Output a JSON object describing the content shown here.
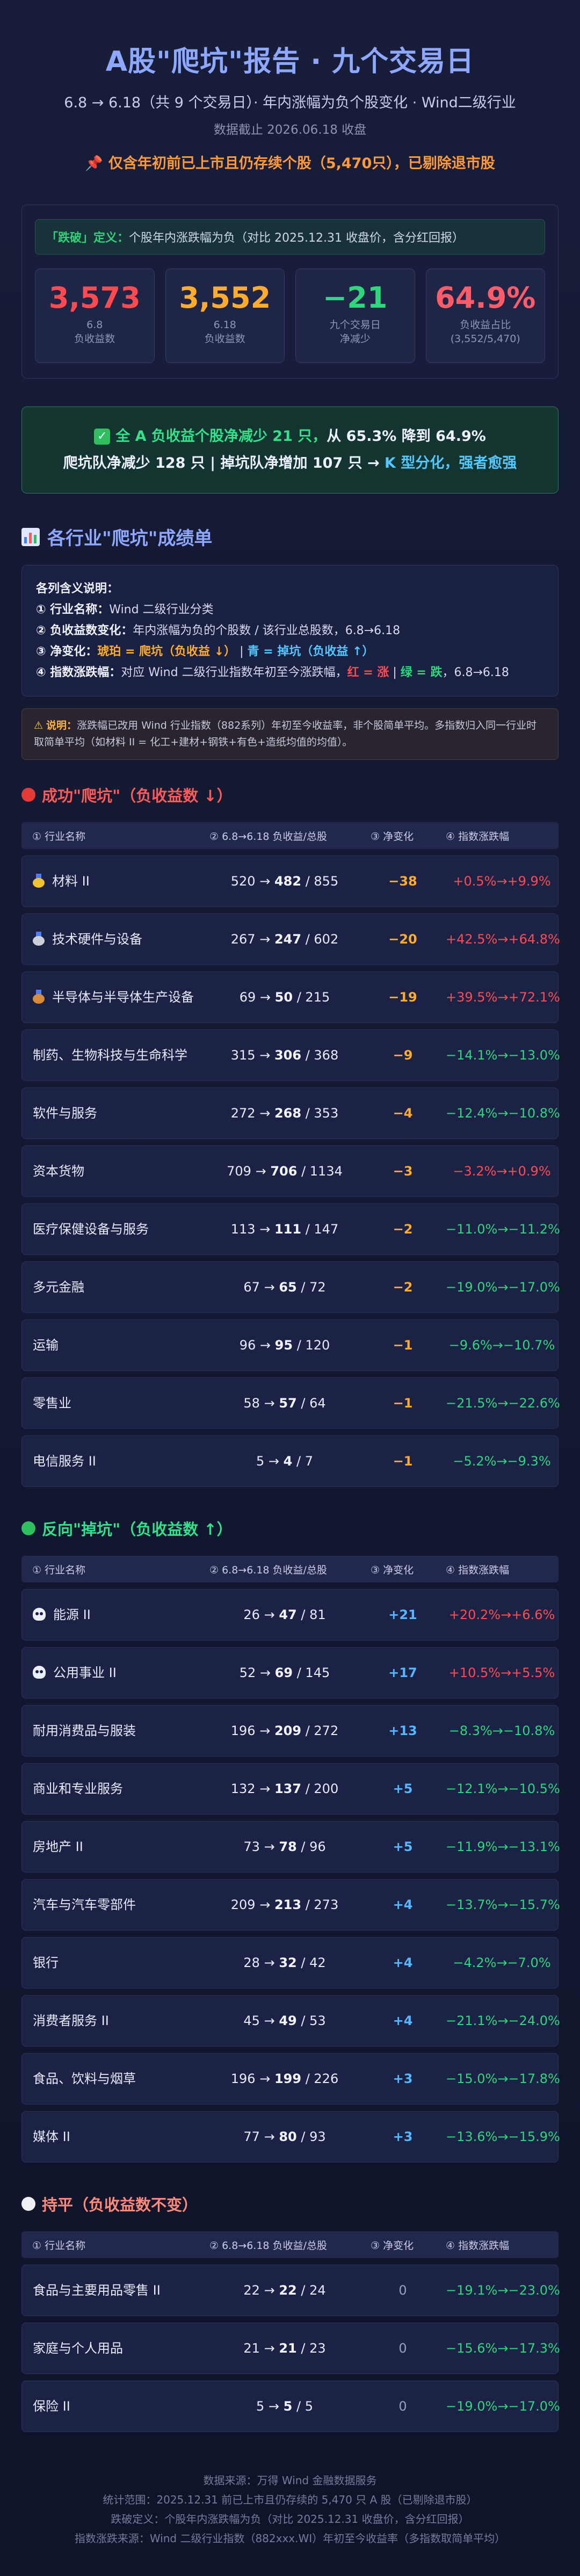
{
  "header": {
    "title": "A股\"爬坑\"报告 · 九个交易日",
    "subtitle": "6.8 → 6.18（共 9 个交易日）· 年内涨幅为负个股变化 · Wind二级行业",
    "cutoff": "数据截止 2026.06.18 收盘",
    "notice": "仅含年初前已上市且仍存续个股（5,470只），已剔除退市股"
  },
  "definition": {
    "label": "「跌破」定义：",
    "text": "个股年内涨跌幅为负（对比 2025.12.31 收盘价，含分红回报）"
  },
  "stats": [
    {
      "value": "3,573",
      "caption": "6.8\n负收益数",
      "color": "#ff4b50"
    },
    {
      "value": "3,552",
      "caption": "6.18\n负收益数",
      "color": "#ffab2e"
    },
    {
      "value": "−21",
      "caption": "九个交易日\n净减少",
      "color": "#2fd67c"
    },
    {
      "value": "64.9%",
      "caption": "负收益占比\n(3,552/5,470)",
      "color": "#ff5c6a"
    }
  ],
  "summary": {
    "line1_a": "全 A 负收益个股净减少 21 只，",
    "line1_b": "从 65.3% 降到 64.9%",
    "line2_a": "爬坑队净减少 128 只 | 掉坑队净增加 107 只 → ",
    "line2_b": "K 型分化，强者愈强"
  },
  "section": {
    "title": "各行业\"爬坑\"成绩单"
  },
  "legend": {
    "heading": "各列含义说明：",
    "l1_label": "① 行业名称：",
    "l1_text": "Wind 二级行业分类",
    "l2_label": "② 负收益数变化：",
    "l2_text": "年内涨幅为负的个股数 / 该行业总股数，6.8→6.18",
    "l3_label": "③ 净变化：",
    "l3_a": "琥珀 = 爬坑（负收益 ↓）",
    "l3_sep": " | ",
    "l3_b": "青 = 掉坑（负收益 ↑）",
    "l4_label": "④ 指数涨跌幅：",
    "l4_a": "对应 Wind 二级行业指数年初至今涨跌幅，",
    "l4_red": "红 = 涨",
    "l4_sep": " | ",
    "l4_green": "绿 = 跌",
    "l4_b": "，6.8→6.18"
  },
  "note": {
    "label": "说明：",
    "text": "涨跌幅已改用 Wind 行业指数（882系列）年初至今收益率，非个股简单平均。多指数归入同一行业时取简单平均（如材料 II = 化工+建材+钢铁+有色+造纸均值的均值）。"
  },
  "columns": {
    "c1": "① 行业名称",
    "c2": "② 6.8→6.18 负收益/总股",
    "c3": "③ 净变化",
    "c4": "④ 指数涨跌幅"
  },
  "groups": {
    "climb": {
      "title": "成功\"爬坑\"（负收益数 ↓）",
      "rows": [
        {
          "name": "材料 II",
          "icon": "gold-medal-icon",
          "from": "520",
          "to": "482",
          "total": "855",
          "change": "−38",
          "index": "+0.5%→+9.9%",
          "dir": "up"
        },
        {
          "name": "技术硬件与设备",
          "icon": "silver-medal-icon",
          "from": "267",
          "to": "247",
          "total": "602",
          "change": "−20",
          "index": "+42.5%→+64.8%",
          "dir": "up"
        },
        {
          "name": "半导体与半导体生产设备",
          "icon": "bronze-medal-icon",
          "from": "69",
          "to": "50",
          "total": "215",
          "change": "−19",
          "index": "+39.5%→+72.1%",
          "dir": "up"
        },
        {
          "name": "制药、生物科技与生命科学",
          "icon": "",
          "from": "315",
          "to": "306",
          "total": "368",
          "change": "−9",
          "index": "−14.1%→−13.0%",
          "dir": "down"
        },
        {
          "name": "软件与服务",
          "icon": "",
          "from": "272",
          "to": "268",
          "total": "353",
          "change": "−4",
          "index": "−12.4%→−10.8%",
          "dir": "down"
        },
        {
          "name": "资本货物",
          "icon": "",
          "from": "709",
          "to": "706",
          "total": "1134",
          "change": "−3",
          "index": "−3.2%→+0.9%",
          "dir": "up"
        },
        {
          "name": "医疗保健设备与服务",
          "icon": "",
          "from": "113",
          "to": "111",
          "total": "147",
          "change": "−2",
          "index": "−11.0%→−11.2%",
          "dir": "down"
        },
        {
          "name": "多元金融",
          "icon": "",
          "from": "67",
          "to": "65",
          "total": "72",
          "change": "−2",
          "index": "−19.0%→−17.0%",
          "dir": "down"
        },
        {
          "name": "运输",
          "icon": "",
          "from": "96",
          "to": "95",
          "total": "120",
          "change": "−1",
          "index": "−9.6%→−10.7%",
          "dir": "down"
        },
        {
          "name": "零售业",
          "icon": "",
          "from": "58",
          "to": "57",
          "total": "64",
          "change": "−1",
          "index": "−21.5%→−22.6%",
          "dir": "down"
        },
        {
          "name": "电信服务 II",
          "icon": "",
          "from": "5",
          "to": "4",
          "total": "7",
          "change": "−1",
          "index": "−5.2%→−9.3%",
          "dir": "down"
        }
      ]
    },
    "fall": {
      "title": "反向\"掉坑\"（负收益数 ↑）",
      "rows": [
        {
          "name": "能源 II",
          "icon": "skull-icon",
          "from": "26",
          "to": "47",
          "total": "81",
          "change": "+21",
          "index": "+20.2%→+6.6%",
          "dir": "up"
        },
        {
          "name": "公用事业 II",
          "icon": "skull-icon",
          "from": "52",
          "to": "69",
          "total": "145",
          "change": "+17",
          "index": "+10.5%→+5.5%",
          "dir": "up"
        },
        {
          "name": "耐用消费品与服装",
          "icon": "",
          "from": "196",
          "to": "209",
          "total": "272",
          "change": "+13",
          "index": "−8.3%→−10.8%",
          "dir": "down"
        },
        {
          "name": "商业和专业服务",
          "icon": "",
          "from": "132",
          "to": "137",
          "total": "200",
          "change": "+5",
          "index": "−12.1%→−10.5%",
          "dir": "down"
        },
        {
          "name": "房地产 II",
          "icon": "",
          "from": "73",
          "to": "78",
          "total": "96",
          "change": "+5",
          "index": "−11.9%→−13.1%",
          "dir": "down"
        },
        {
          "name": "汽车与汽车零部件",
          "icon": "",
          "from": "209",
          "to": "213",
          "total": "273",
          "change": "+4",
          "index": "−13.7%→−15.7%",
          "dir": "down"
        },
        {
          "name": "银行",
          "icon": "",
          "from": "28",
          "to": "32",
          "total": "42",
          "change": "+4",
          "index": "−4.2%→−7.0%",
          "dir": "down"
        },
        {
          "name": "消费者服务 II",
          "icon": "",
          "from": "45",
          "to": "49",
          "total": "53",
          "change": "+4",
          "index": "−21.1%→−24.0%",
          "dir": "down"
        },
        {
          "name": "食品、饮料与烟草",
          "icon": "",
          "from": "196",
          "to": "199",
          "total": "226",
          "change": "+3",
          "index": "−15.0%→−17.8%",
          "dir": "down"
        },
        {
          "name": "媒体 II",
          "icon": "",
          "from": "77",
          "to": "80",
          "total": "93",
          "change": "+3",
          "index": "−13.6%→−15.9%",
          "dir": "down"
        }
      ]
    },
    "flat": {
      "title": "持平（负收益数不变）",
      "rows": [
        {
          "name": "食品与主要用品零售 II",
          "icon": "",
          "from": "22",
          "to": "22",
          "total": "24",
          "change": "0",
          "index": "−19.1%→−23.0%",
          "dir": "down"
        },
        {
          "name": "家庭与个人用品",
          "icon": "",
          "from": "21",
          "to": "21",
          "total": "23",
          "change": "0",
          "index": "−15.6%→−17.3%",
          "dir": "down"
        },
        {
          "name": "保险 II",
          "icon": "",
          "from": "5",
          "to": "5",
          "total": "5",
          "change": "0",
          "index": "−19.0%→−17.0%",
          "dir": "down"
        }
      ]
    }
  },
  "footer": {
    "line1": "数据来源：万得 Wind 金融数据服务",
    "line2": "统计范围：2025.12.31 前已上市且仍存续的 5,470 只 A 股（已剔除退市股）",
    "line3": "跌破定义：个股年内涨跌幅为负（对比 2025.12.31 收盘价，含分红回报）",
    "line4": "指数涨跌来源：Wind 二级行业指数（882xxx.WI）年初至今收益率（多指数取简单平均）"
  },
  "chart_data": {
    "type": "table",
    "columns": [
      "行业名称",
      "6.8 负收益数",
      "6.18 负收益数",
      "总股数",
      "净变化",
      "指数涨跌幅 6.8",
      "指数涨跌幅 6.18"
    ],
    "rows": [
      [
        "材料 II",
        520,
        482,
        855,
        -38,
        0.5,
        9.9
      ],
      [
        "技术硬件与设备",
        267,
        247,
        602,
        -20,
        42.5,
        64.8
      ],
      [
        "半导体与半导体生产设备",
        69,
        50,
        215,
        -19,
        39.5,
        72.1
      ],
      [
        "制药、生物科技与生命科学",
        315,
        306,
        368,
        -9,
        -14.1,
        -13.0
      ],
      [
        "软件与服务",
        272,
        268,
        353,
        -4,
        -12.4,
        -10.8
      ],
      [
        "资本货物",
        709,
        706,
        1134,
        -3,
        -3.2,
        0.9
      ],
      [
        "医疗保健设备与服务",
        113,
        111,
        147,
        -2,
        -11.0,
        -11.2
      ],
      [
        "多元金融",
        67,
        65,
        72,
        -2,
        -19.0,
        -17.0
      ],
      [
        "运输",
        96,
        95,
        120,
        -1,
        -9.6,
        -10.7
      ],
      [
        "零售业",
        58,
        57,
        64,
        -1,
        -21.5,
        -22.6
      ],
      [
        "电信服务 II",
        5,
        4,
        7,
        -1,
        -5.2,
        -9.3
      ],
      [
        "能源 II",
        26,
        47,
        81,
        21,
        20.2,
        6.6
      ],
      [
        "公用事业 II",
        52,
        69,
        145,
        17,
        10.5,
        5.5
      ],
      [
        "耐用消费品与服装",
        196,
        209,
        272,
        13,
        -8.3,
        -10.8
      ],
      [
        "商业和专业服务",
        132,
        137,
        200,
        5,
        -12.1,
        -10.5
      ],
      [
        "房地产 II",
        73,
        78,
        96,
        5,
        -11.9,
        -13.1
      ],
      [
        "汽车与汽车零部件",
        209,
        213,
        273,
        4,
        -13.7,
        -15.7
      ],
      [
        "银行",
        28,
        32,
        42,
        4,
        -4.2,
        -7.0
      ],
      [
        "消费者服务 II",
        45,
        49,
        53,
        4,
        -21.1,
        -24.0
      ],
      [
        "食品、饮料与烟草",
        196,
        199,
        226,
        3,
        -15.0,
        -17.8
      ],
      [
        "媒体 II",
        77,
        80,
        93,
        3,
        -13.6,
        -15.9
      ],
      [
        "食品与主要用品零售 II",
        22,
        22,
        24,
        0,
        -19.1,
        -23.0
      ],
      [
        "家庭与个人用品",
        21,
        21,
        23,
        0,
        -15.6,
        -17.3
      ],
      [
        "保险 II",
        5,
        5,
        5,
        0,
        -19.0,
        -17.0
      ]
    ]
  }
}
